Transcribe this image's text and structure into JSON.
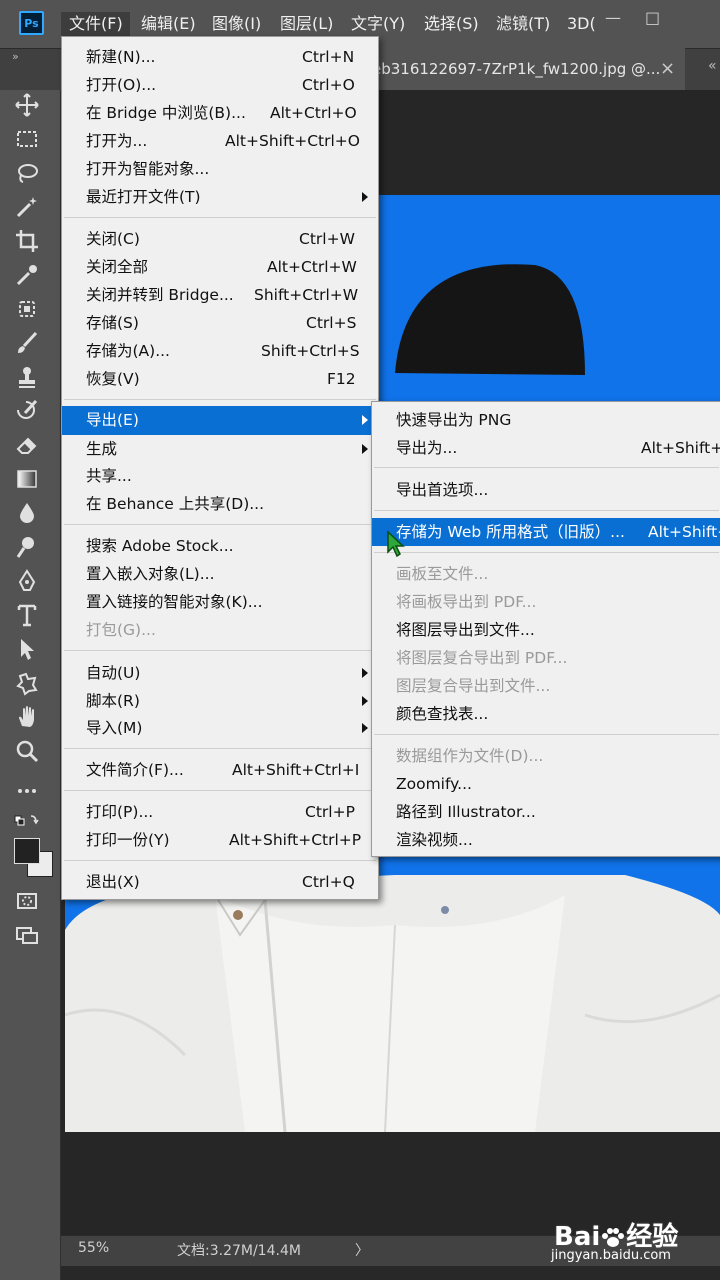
{
  "app_icon": "Ps",
  "menubar": {
    "items": [
      "文件(F)",
      "编辑(E)",
      "图像(I)",
      "图层(L)",
      "文字(Y)",
      "选择(S)",
      "滤镜(T)",
      "3D("
    ],
    "min": "—",
    "max": "□"
  },
  "collapse_left": "»",
  "collapse_right": "«",
  "document_tab": {
    "title": "eb316122697-7ZrP1k_fw1200.jpg @...",
    "close": "×"
  },
  "status": {
    "zoom": "55%",
    "doc_info": "文档:3.27M/14.4M",
    "arrow": "〉"
  },
  "file_menu": {
    "groups": [
      [
        {
          "label": "新建(N)...",
          "shortcut": "Ctrl+N"
        },
        {
          "label": "打开(O)...",
          "shortcut": "Ctrl+O"
        },
        {
          "label": "在 Bridge 中浏览(B)...",
          "shortcut": "Alt+Ctrl+O"
        },
        {
          "label": "打开为...",
          "shortcut": "Alt+Shift+Ctrl+O"
        },
        {
          "label": "打开为智能对象...",
          "shortcut": ""
        },
        {
          "label": "最近打开文件(T)",
          "shortcut": "",
          "submenu": true
        }
      ],
      [
        {
          "label": "关闭(C)",
          "shortcut": "Ctrl+W"
        },
        {
          "label": "关闭全部",
          "shortcut": "Alt+Ctrl+W"
        },
        {
          "label": "关闭并转到 Bridge...",
          "shortcut": "Shift+Ctrl+W"
        },
        {
          "label": "存储(S)",
          "shortcut": "Ctrl+S"
        },
        {
          "label": "存储为(A)...",
          "shortcut": "Shift+Ctrl+S"
        },
        {
          "label": "恢复(V)",
          "shortcut": "F12"
        }
      ],
      [
        {
          "label": "导出(E)",
          "shortcut": "",
          "submenu": true,
          "highlighted": true
        },
        {
          "label": "生成",
          "shortcut": "",
          "submenu": true
        },
        {
          "label": "共享...",
          "shortcut": ""
        },
        {
          "label": "在 Behance 上共享(D)...",
          "shortcut": ""
        }
      ],
      [
        {
          "label": "搜索 Adobe Stock...",
          "shortcut": ""
        },
        {
          "label": "置入嵌入对象(L)...",
          "shortcut": ""
        },
        {
          "label": "置入链接的智能对象(K)...",
          "shortcut": ""
        },
        {
          "label": "打包(G)...",
          "shortcut": "",
          "disabled": true
        }
      ],
      [
        {
          "label": "自动(U)",
          "shortcut": "",
          "submenu": true
        },
        {
          "label": "脚本(R)",
          "shortcut": "",
          "submenu": true
        },
        {
          "label": "导入(M)",
          "shortcut": "",
          "submenu": true
        }
      ],
      [
        {
          "label": "文件简介(F)...",
          "shortcut": "Alt+Shift+Ctrl+I"
        }
      ],
      [
        {
          "label": "打印(P)...",
          "shortcut": "Ctrl+P"
        },
        {
          "label": "打印一份(Y)",
          "shortcut": "Alt+Shift+Ctrl+P"
        }
      ],
      [
        {
          "label": "退出(X)",
          "shortcut": "Ctrl+Q"
        }
      ]
    ]
  },
  "export_menu": {
    "groups": [
      [
        {
          "label": "快速导出为 PNG",
          "shortcut": ""
        },
        {
          "label": "导出为...",
          "shortcut": "Alt+Shift+C"
        }
      ],
      [
        {
          "label": "导出首选项...",
          "shortcut": ""
        }
      ],
      [
        {
          "label": "存储为 Web 所用格式（旧版）...",
          "shortcut": "Alt+Shift+",
          "highlighted": true
        }
      ],
      [
        {
          "label": "画板至文件...",
          "shortcut": "",
          "disabled": true
        },
        {
          "label": "将画板导出到 PDF...",
          "shortcut": "",
          "disabled": true
        },
        {
          "label": "将图层导出到文件...",
          "shortcut": ""
        },
        {
          "label": "将图层复合导出到 PDF...",
          "shortcut": "",
          "disabled": true
        },
        {
          "label": "图层复合导出到文件...",
          "shortcut": "",
          "disabled": true
        },
        {
          "label": "颜色查找表...",
          "shortcut": ""
        }
      ],
      [
        {
          "label": "数据组作为文件(D)...",
          "shortcut": "",
          "disabled": true
        },
        {
          "label": "Zoomify...",
          "shortcut": ""
        },
        {
          "label": "路径到 Illustrator...",
          "shortcut": ""
        },
        {
          "label": "渲染视频...",
          "shortcut": ""
        }
      ]
    ]
  },
  "watermark": {
    "brand": "Bai",
    "brand_cn": "经验",
    "url": "jingyan.baidu.com"
  },
  "colors": {
    "canvas_bg": "#1073ea",
    "highlight": "#0a6fd3",
    "menu_bg": "#f0f0f0",
    "ui_dark": "#535353"
  }
}
